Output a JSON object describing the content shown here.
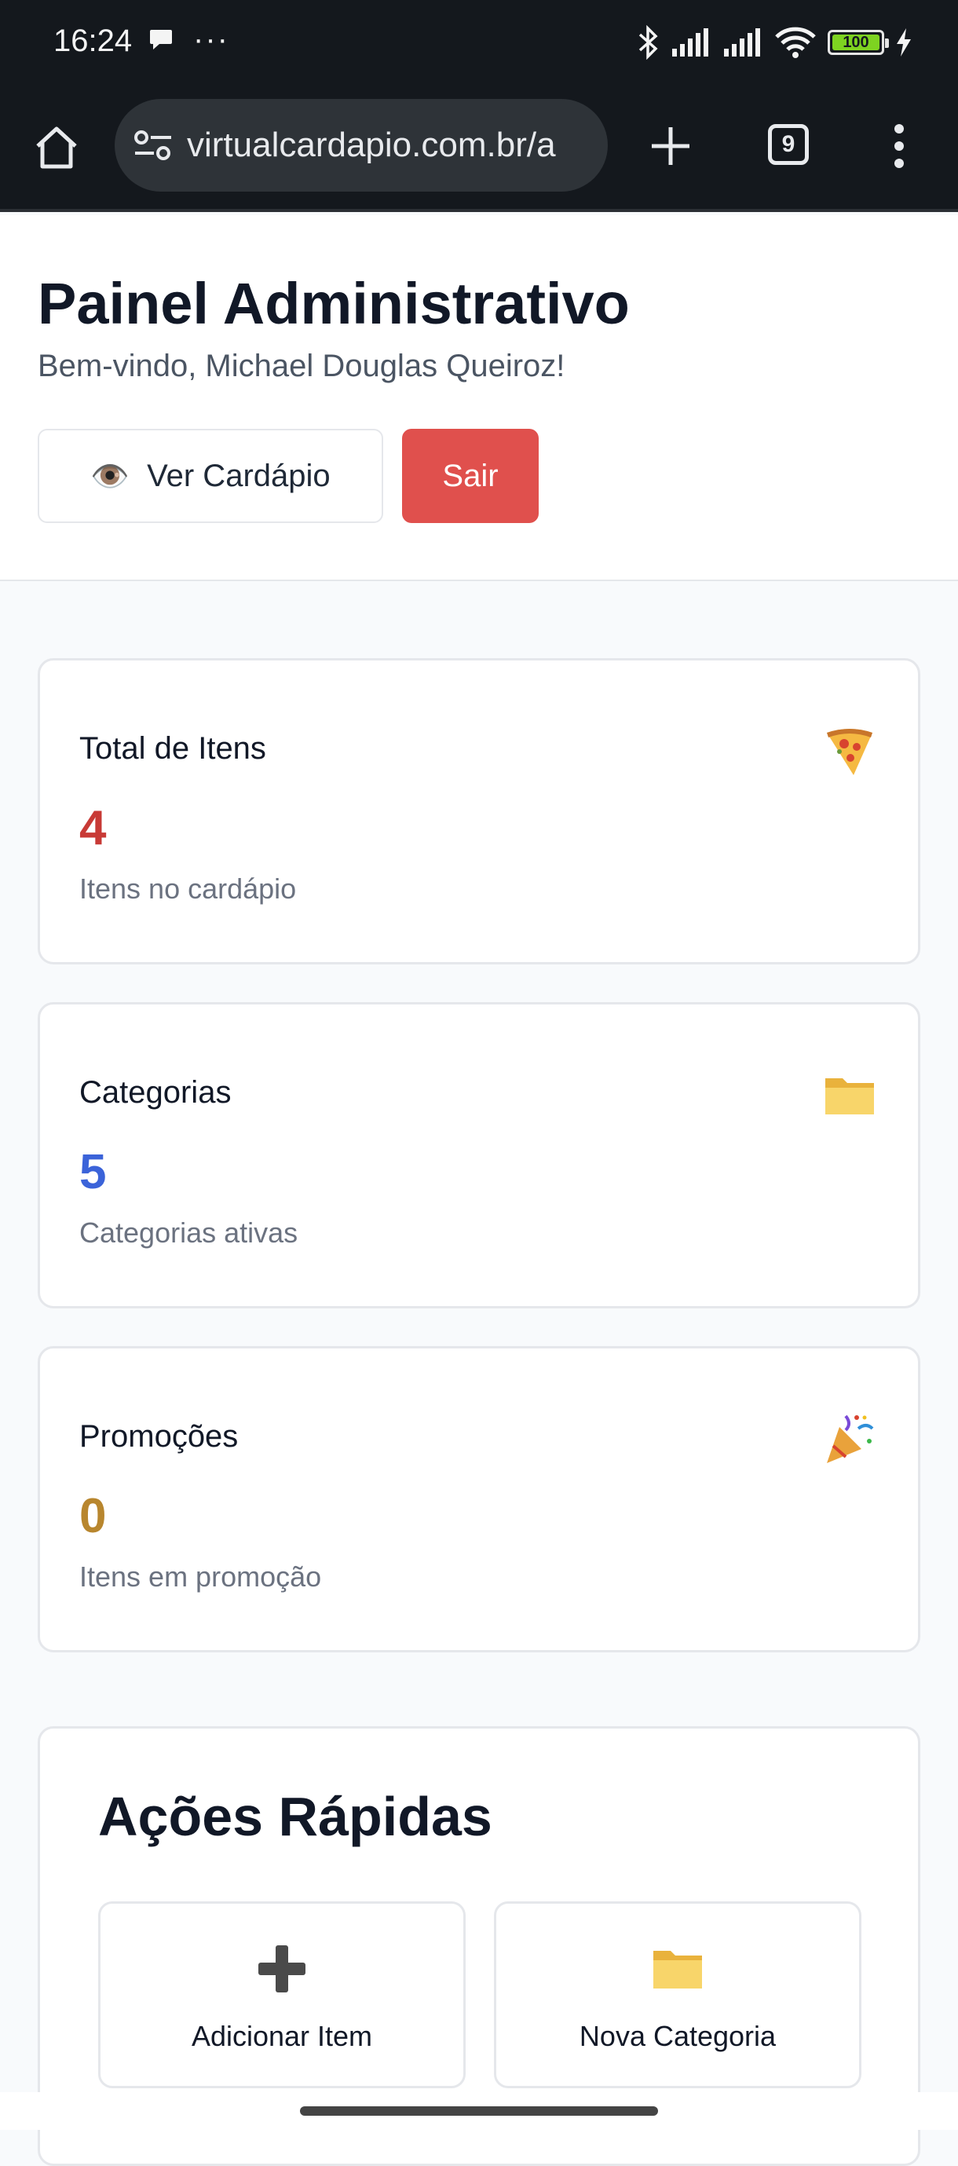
{
  "status_bar": {
    "time": "16:24",
    "battery_level": "100"
  },
  "browser": {
    "url": "virtualcardapio.com.br/a",
    "tab_count": "9"
  },
  "header": {
    "title": "Painel Administrativo",
    "welcome": "Bem-vindo, Michael Douglas Queiroz!",
    "view_menu_label": "Ver Cardápio",
    "view_menu_icon": "👁️",
    "logout_label": "Sair"
  },
  "stats": [
    {
      "title": "Total de Itens",
      "value": "4",
      "subtitle": "Itens no cardápio",
      "icon": "pizza-icon",
      "color": "#c83a36"
    },
    {
      "title": "Categorias",
      "value": "5",
      "subtitle": "Categorias ativas",
      "icon": "folder-icon",
      "color": "#3b63d9"
    },
    {
      "title": "Promoções",
      "value": "0",
      "subtitle": "Itens em promoção",
      "icon": "party-popper-icon",
      "color": "#b8862e"
    }
  ],
  "quick_actions": {
    "title": "Ações Rápidas",
    "items": [
      {
        "label": "Adicionar Item",
        "icon": "plus-icon"
      },
      {
        "label": "Nova Categoria",
        "icon": "folder-icon"
      }
    ]
  },
  "colors": {
    "logout_bg": "#e0504d",
    "browser_bg": "#14181d"
  }
}
